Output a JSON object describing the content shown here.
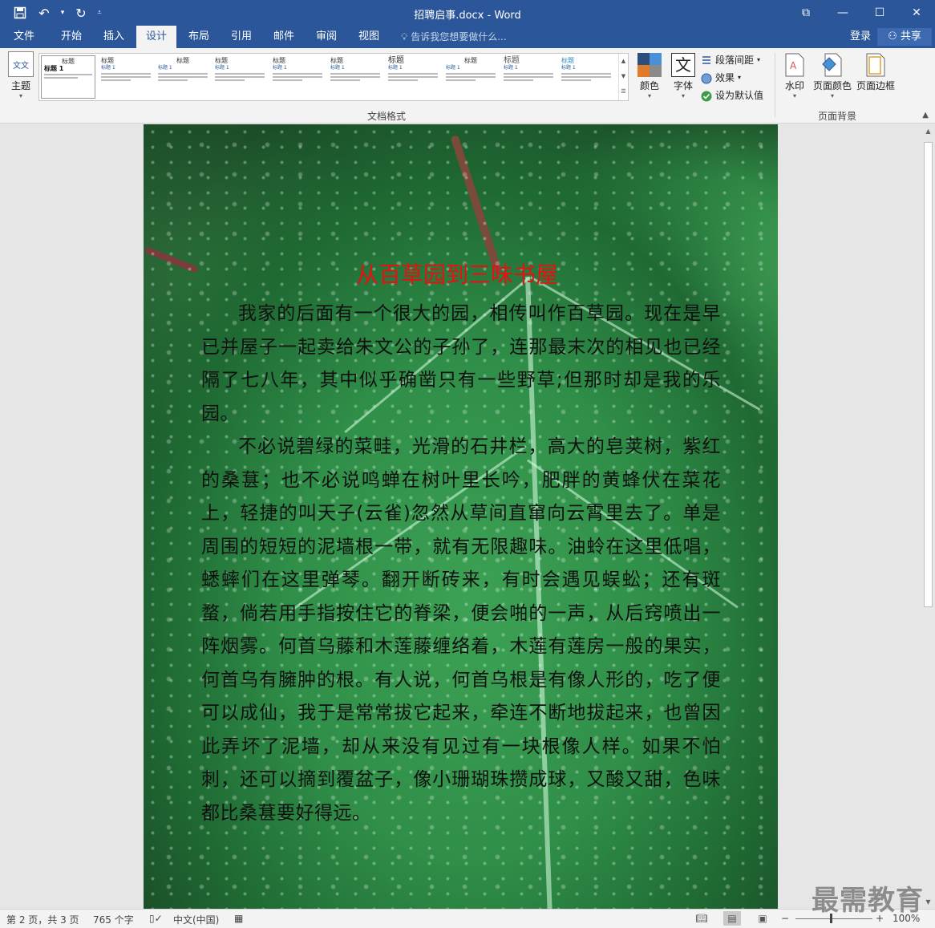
{
  "titlebar": {
    "title": "招聘启事.docx - Word",
    "controls": [
      "⧉",
      "—",
      "☐",
      "✕"
    ]
  },
  "tabs": [
    {
      "label": "文件"
    },
    {
      "label": "开始"
    },
    {
      "label": "插入"
    },
    {
      "label": "设计",
      "active": true
    },
    {
      "label": "布局"
    },
    {
      "label": "引用"
    },
    {
      "label": "邮件"
    },
    {
      "label": "审阅"
    },
    {
      "label": "视图"
    }
  ],
  "tell_me": "告诉我您想要做什么...",
  "login": "登录",
  "share": "共享",
  "ribbon": {
    "theme_label": "主题",
    "theme_icon_text": "文文",
    "gallery": [
      {
        "title": "标题",
        "heading": "标题 1"
      },
      {
        "title": "标题",
        "heading": "标题 1"
      },
      {
        "title": "标题",
        "heading": "标题 1"
      },
      {
        "title": "标题",
        "heading": "标题 1"
      },
      {
        "title": "标题",
        "heading": "标题 1"
      },
      {
        "title": "标题",
        "heading": "标题 1"
      },
      {
        "title": "标题",
        "heading": "标题 1"
      },
      {
        "title": "标题",
        "heading": "标题 1"
      },
      {
        "title": "标题",
        "heading": "标题 1"
      },
      {
        "title": "标题",
        "heading": "标题 1"
      }
    ],
    "group_doc_format": "文档格式",
    "colors_label": "颜色",
    "fonts_label": "字体",
    "fonts_icon_text": "文",
    "paragraph_spacing": "段落间距",
    "effects": "效果",
    "set_default": "设为默认值",
    "watermark_label": "水印",
    "page_color_label": "页面颜色",
    "page_borders_label": "页面边框",
    "group_page_background": "页面背景"
  },
  "document": {
    "heading": "从百草园到三味书屋",
    "paragraphs": [
      "我家的后面有一个很大的园，相传叫作百草园。现在是早已并屋子一起卖给朱文公的子孙了，连那最末次的相见也已经隔了七八年，其中似乎确凿只有一些野草;但那时却是我的乐园。",
      "不必说碧绿的菜畦，光滑的石井栏，高大的皂荚树，紫红的桑葚；也不必说鸣蝉在树叶里长吟，肥胖的黄蜂伏在菜花上，轻捷的叫天子(云雀)忽然从草间直窜向云霄里去了。单是周围的短短的泥墙根一带，就有无限趣味。油蛉在这里低唱，蟋蟀们在这里弹琴。翻开断砖来，有时会遇见蜈蚣；还有斑蝥，倘若用手指按住它的脊梁，便会啪的一声，从后窍喷出一阵烟雾。何首乌藤和木莲藤缠络着，木莲有莲房一般的果实，何首乌有臃肿的根。有人说，何首乌根是有像人形的，吃了便可以成仙，我于是常常拔它起来，牵连不断地拔起来，也曾因此弄坏了泥墙，却从来没有见过有一块根像人样。如果不怕刺，还可以摘到覆盆子，像小珊瑚珠攒成球，又酸又甜，色味都比桑葚要好得远。"
    ]
  },
  "statusbar": {
    "page": "第 2 页，共 3 页",
    "words": "765 个字",
    "language": "中文(中国)",
    "zoom_minus": "−",
    "zoom_plus": "+",
    "zoom": "100%"
  },
  "watermark_text": "最需教育"
}
